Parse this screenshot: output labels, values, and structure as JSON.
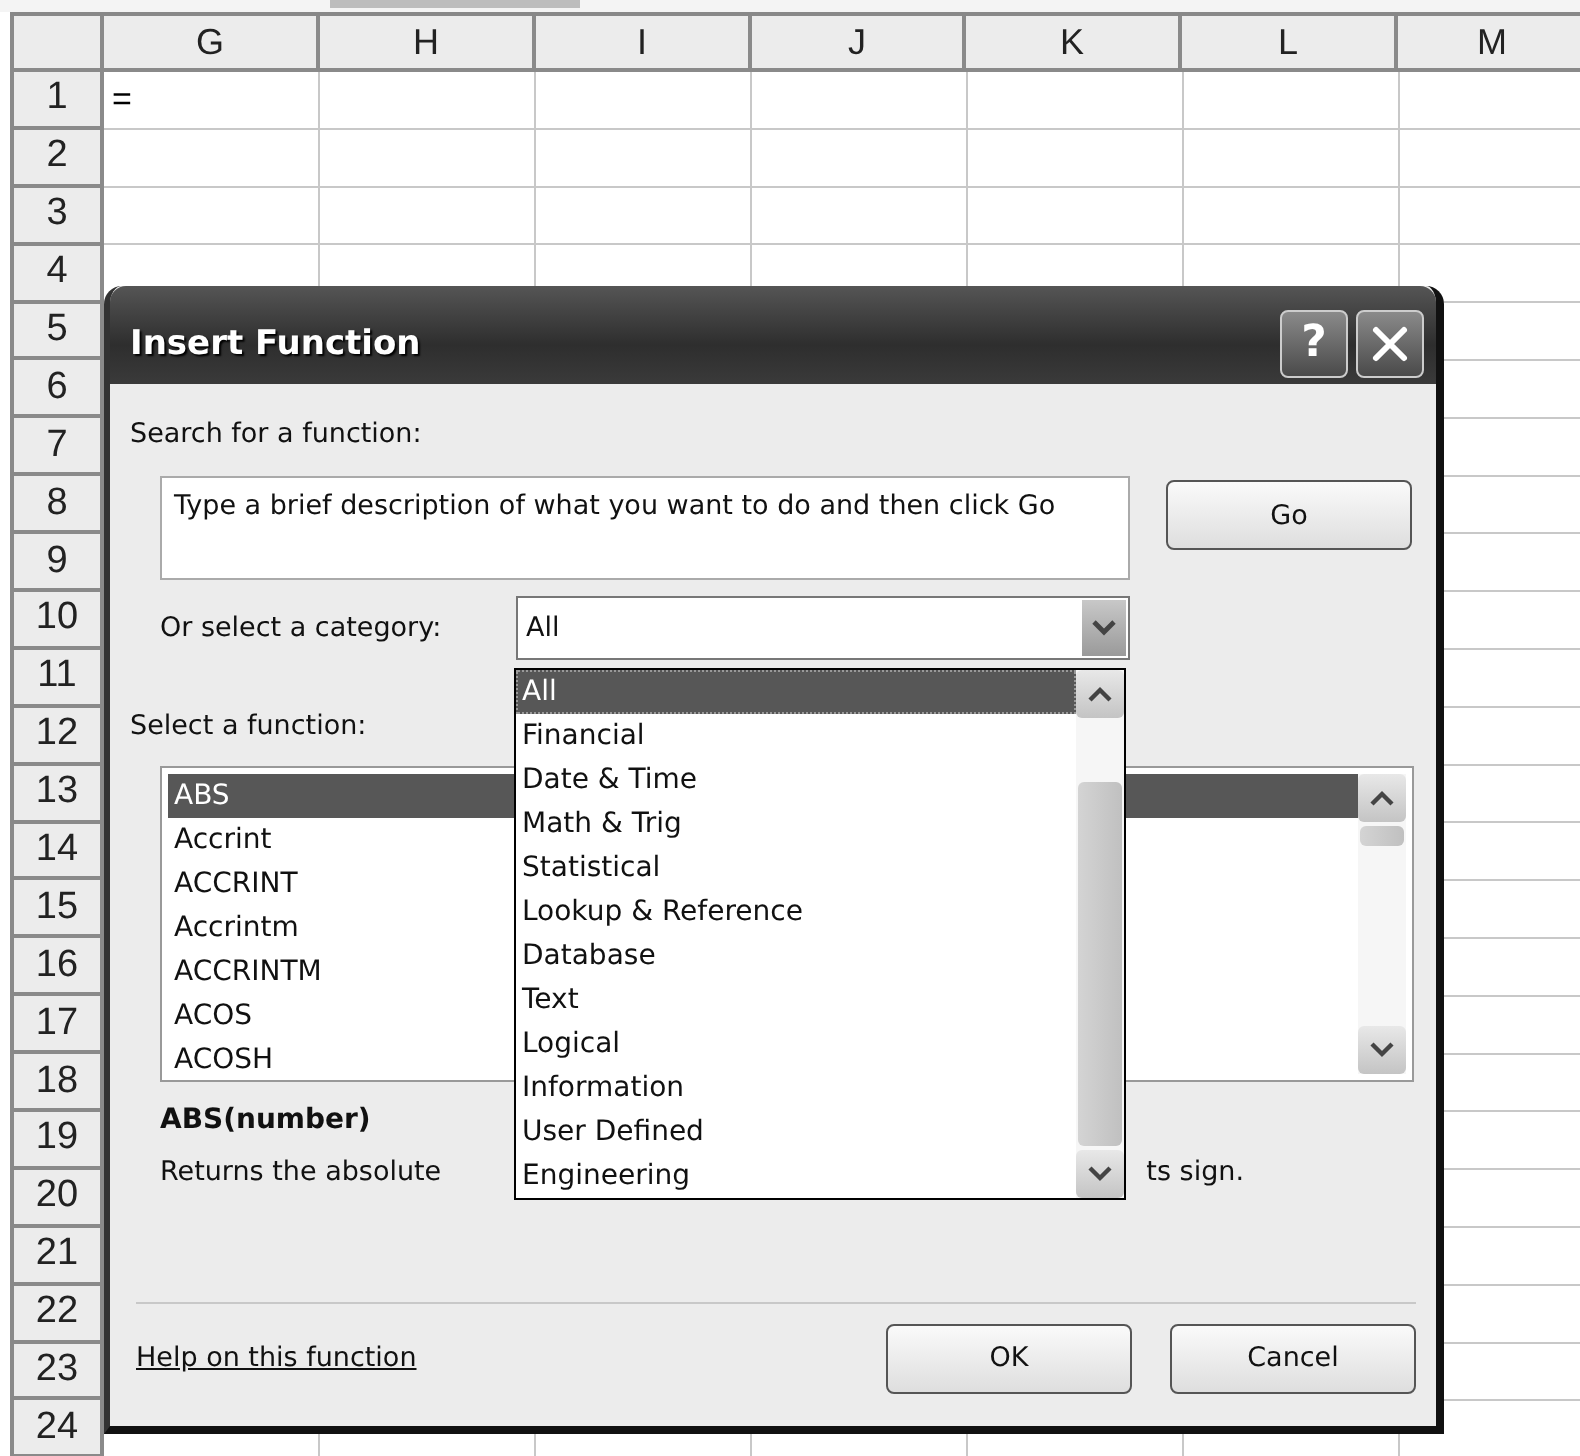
{
  "sheet": {
    "columns": [
      "G",
      "H",
      "I",
      "J",
      "K",
      "L",
      "M"
    ],
    "rows": [
      {
        "label": "1",
        "cells": [
          "="
        ]
      },
      {
        "label": "2"
      },
      {
        "label": "3"
      },
      {
        "label": "4"
      },
      {
        "label": "5"
      },
      {
        "label": "6"
      },
      {
        "label": "7"
      },
      {
        "label": "8"
      },
      {
        "label": "9"
      },
      {
        "label": "10"
      },
      {
        "label": "11"
      },
      {
        "label": "12"
      },
      {
        "label": "13"
      },
      {
        "label": "14"
      },
      {
        "label": "15"
      },
      {
        "label": "16"
      },
      {
        "label": "17"
      },
      {
        "label": "18"
      },
      {
        "label": "19"
      },
      {
        "label": "20"
      },
      {
        "label": "21"
      },
      {
        "label": "22"
      },
      {
        "label": "23"
      },
      {
        "label": "24"
      }
    ]
  },
  "dialog": {
    "title": "Insert Function",
    "help_button": "?",
    "search_label": "Search for a function:",
    "search_field": {
      "value": "Type a brief description of what you want to do and then click Go"
    },
    "go_button": "Go",
    "category_label": "Or select a category:",
    "category": {
      "value": "All",
      "expanded": true,
      "options": [
        {
          "label": "All",
          "selected": true
        },
        {
          "label": "Financial",
          "selected": false
        },
        {
          "label": "Date & Time",
          "selected": false
        },
        {
          "label": "Math & Trig",
          "selected": false
        },
        {
          "label": "Statistical",
          "selected": false
        },
        {
          "label": "Lookup & Reference",
          "selected": false
        },
        {
          "label": "Database",
          "selected": false
        },
        {
          "label": "Text",
          "selected": false
        },
        {
          "label": "Logical",
          "selected": false
        },
        {
          "label": "Information",
          "selected": false
        },
        {
          "label": "User Defined",
          "selected": false
        },
        {
          "label": "Engineering",
          "selected": false
        }
      ]
    },
    "function_label": "Select a function:",
    "functions": [
      {
        "name": "ABS",
        "selected": true
      },
      {
        "name": "Accrint",
        "selected": false
      },
      {
        "name": "ACCRINT",
        "selected": false
      },
      {
        "name": "Accrintm",
        "selected": false
      },
      {
        "name": "ACCRINTM",
        "selected": false
      },
      {
        "name": "ACOS",
        "selected": false
      },
      {
        "name": "ACOSH",
        "selected": false
      }
    ],
    "signature": "ABS(number)",
    "description_start": "Returns the absolute",
    "description_end": "ts sign.",
    "help_link": "Help on this function",
    "buttons": [
      "OK",
      "Cancel"
    ]
  }
}
